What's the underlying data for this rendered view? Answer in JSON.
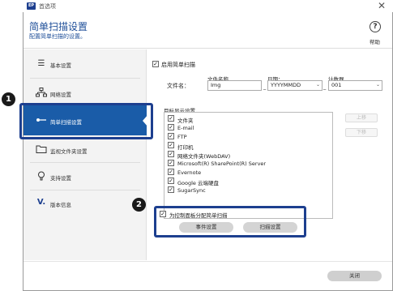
{
  "window": {
    "title": "首选项",
    "app_icon_text": "EP",
    "close_glyph": "✕"
  },
  "header": {
    "title": "简单扫描设置",
    "subtitle": "配置简单扫描的设置。",
    "help_label": "帮助",
    "help_glyph": "?"
  },
  "sidebar": {
    "items": [
      {
        "label": "基本设置",
        "icon": "list-icon"
      },
      {
        "label": "网络设置",
        "icon": "network-icon"
      },
      {
        "label": "简单扫描设置",
        "icon": "key-icon",
        "active": true
      },
      {
        "label": "监视文件夹设置",
        "icon": "folder-icon"
      },
      {
        "label": "支持设置",
        "icon": "bulb-icon"
      },
      {
        "label": "版本信息",
        "icon": "v-logo-icon"
      }
    ]
  },
  "callouts": {
    "first": "1",
    "second": "2"
  },
  "main": {
    "enable_label": "启用简单扫描",
    "enable_checked": true,
    "filename_label": "文件名：",
    "prefix_header": "文件名称",
    "prefix_value": "Img",
    "date_header": "日期：",
    "date_value": "YYYYMMDD",
    "counter_header": "计数器",
    "counter_value": "001",
    "separator": "_",
    "targets_label": "目标显示设置",
    "targets": [
      {
        "label": "文件夹",
        "checked": true
      },
      {
        "label": "E-mail",
        "checked": true
      },
      {
        "label": "FTP",
        "checked": true
      },
      {
        "label": "打印机",
        "checked": true
      },
      {
        "label": "网络文件夹(WebDAV)",
        "checked": true
      },
      {
        "label": "Microsoft(R) SharePoint(R) Server",
        "checked": true
      },
      {
        "label": "Evernote",
        "checked": true
      },
      {
        "label": "Google 云端硬盘",
        "checked": true
      },
      {
        "label": "SugarSync",
        "checked": true
      }
    ],
    "move_up": "上移",
    "move_down": "下移",
    "assign_label": "为控制面板分配简单扫描",
    "assign_checked": true,
    "event_button": "事件设置",
    "scan_button": "扫描设置"
  },
  "footer": {
    "close_button": "关闭"
  },
  "colors": {
    "accent": "#1a5ca8",
    "callout": "#1d3f8f",
    "title_blue": "#1f4f99"
  }
}
